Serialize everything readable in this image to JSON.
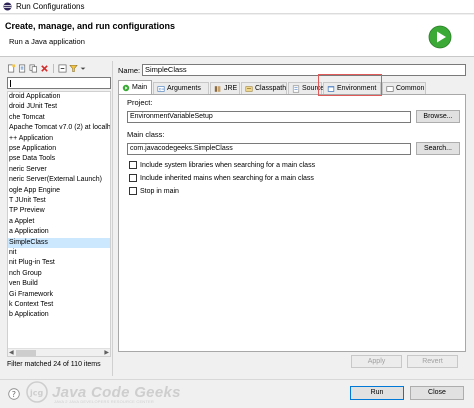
{
  "window": {
    "title": "Run Configurations"
  },
  "header": {
    "title": "Create, manage, and run configurations",
    "subtitle": "Run a Java application"
  },
  "sidebar": {
    "filter_value": "",
    "items": [
      "droid Application",
      "droid JUnit Test",
      "che Tomcat",
      "Apache Tomcat v7.0 (2) at localh",
      "++ Application",
      "pse Application",
      "pse Data Tools",
      "neric Server",
      "neric Server(External Launch)",
      "ogle App Engine",
      "T JUnit Test",
      "TP Preview",
      "a Applet",
      "a Application",
      "SimpleClass",
      "nit",
      "nit Plug-in Test",
      "nch Group",
      "ven Build",
      "Gi Framework",
      "k Context Test",
      "b Application"
    ],
    "selected_index": 14,
    "status": "Filter matched 24 of 110 items"
  },
  "config": {
    "name_label": "Name:",
    "name_value": "SimpleClass",
    "tabs": [
      "Main",
      "Arguments",
      "JRE",
      "Classpath",
      "Source",
      "Environment",
      "Common"
    ],
    "active_tab": "Main",
    "project_label": "Project:",
    "project_value": "EnvironmentVariableSetup",
    "browse_label": "Browse...",
    "main_class_label": "Main class:",
    "main_class_value": "com.javacodegeeks.SimpleClass",
    "search_label": "Search...",
    "checkboxes": [
      "Include system libraries when searching for a main class",
      "Include inherited mains when searching for a main class",
      "Stop in main"
    ],
    "apply_label": "Apply",
    "revert_label": "Revert"
  },
  "footer": {
    "run_label": "Run",
    "close_label": "Close"
  },
  "watermark": {
    "text": "Java Code Geeks",
    "sub": "JAVA 2 JAVA DEVELOPERS RESOURCE CENTER"
  },
  "colors": {
    "selection": "#cce8ff",
    "highlight_box": "#e05a5a",
    "run_green": "#3aa935"
  }
}
